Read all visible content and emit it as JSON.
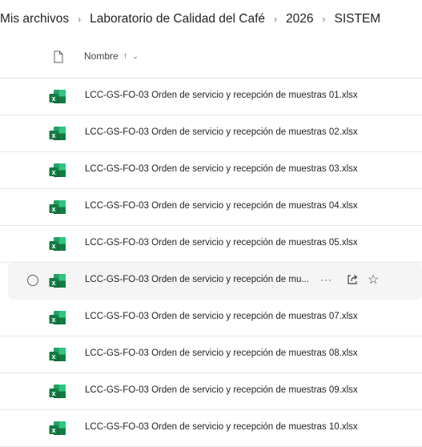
{
  "breadcrumb": [
    {
      "label": "Mis archivos"
    },
    {
      "label": "Laboratorio de Calidad del Café"
    },
    {
      "label": "2026"
    },
    {
      "label": "SISTEM"
    }
  ],
  "breadcrumb_separator": "›",
  "header": {
    "name_label": "Nombre",
    "sort_glyph": "↑",
    "chevron_glyph": "⌄"
  },
  "files": [
    {
      "name": "LCC-GS-FO-03 Orden de servicio y recepción de muestras 01.xlsx"
    },
    {
      "name": "LCC-GS-FO-03 Orden de servicio y recepción de muestras 02.xlsx"
    },
    {
      "name": "LCC-GS-FO-03 Orden de servicio y recepción de muestras 03.xlsx"
    },
    {
      "name": "LCC-GS-FO-03 Orden de servicio y recepción de muestras 04.xlsx"
    },
    {
      "name": "LCC-GS-FO-03 Orden de servicio y recepción de muestras 05.xlsx"
    },
    {
      "name": "LCC-GS-FO-03 Orden de servicio y recepción de mu...",
      "hovered": true
    },
    {
      "name": "LCC-GS-FO-03 Orden de servicio y recepción de muestras 07.xlsx"
    },
    {
      "name": "LCC-GS-FO-03 Orden de servicio y recepción de muestras 08.xlsx"
    },
    {
      "name": "LCC-GS-FO-03 Orden de servicio y recepción de muestras 09.xlsx"
    },
    {
      "name": "LCC-GS-FO-03 Orden de servicio y recepción de muestras 10.xlsx"
    }
  ],
  "row_actions": {
    "more_glyph": "···",
    "star_glyph": "☆"
  },
  "icons": {
    "file_type": "excel-icon",
    "header": "file-icon",
    "more": "more-icon",
    "share": "share-icon",
    "favorite": "star-icon"
  },
  "colors": {
    "excel_green": "#107c41",
    "excel_light": "#21a366",
    "hover_bg": "#f5f5f5"
  }
}
